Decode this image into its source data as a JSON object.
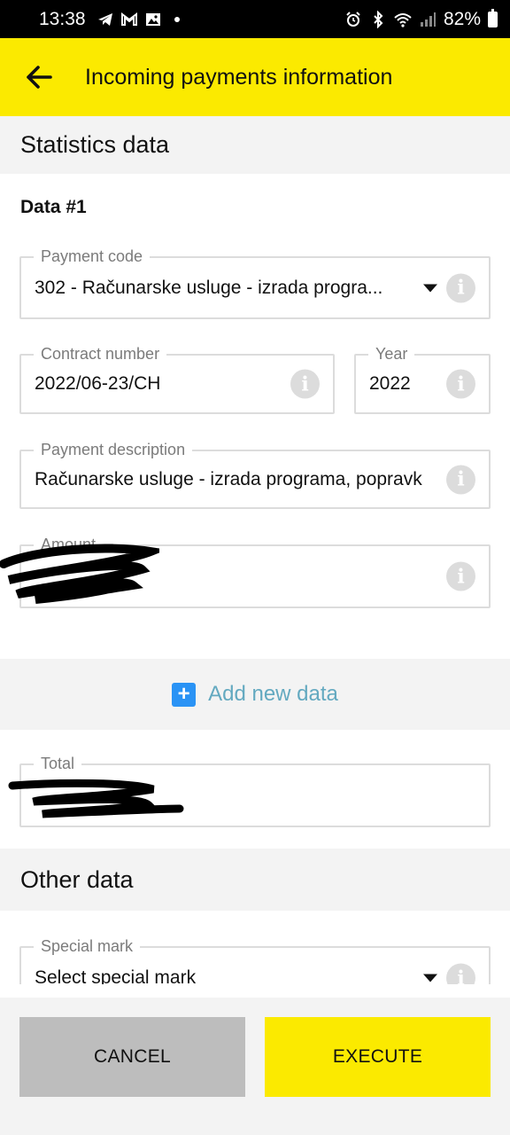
{
  "status_bar": {
    "time": "13:38",
    "battery": "82%",
    "left_icons": [
      "telegram-icon",
      "gmail-icon",
      "gallery-icon",
      "dot-icon"
    ],
    "right_icons": [
      "alarm-icon",
      "bluetooth-icon",
      "wifi-icon",
      "signal-icon"
    ]
  },
  "app_bar": {
    "title": "Incoming payments information",
    "back_icon": "arrow-left-icon",
    "background": "#fbea00"
  },
  "statistics": {
    "heading": "Statistics data",
    "data_heading": "Data #1",
    "payment_code": {
      "label": "Payment code",
      "value": "302 - Računarske usluge - izrada progra..."
    },
    "contract_number": {
      "label": "Contract number",
      "value": "2022/06-23/CH"
    },
    "year": {
      "label": "Year",
      "value": "2022"
    },
    "payment_description": {
      "label": "Payment description",
      "value": "Računarske usluge - izrada programa, popravk"
    },
    "amount": {
      "label": "Amount"
    }
  },
  "add_new": {
    "label": "Add new data",
    "icon": "plus-square-icon"
  },
  "total": {
    "label": "Total"
  },
  "other": {
    "heading": "Other data",
    "special_mark": {
      "label": "Special mark",
      "placeholder": "Select special mark"
    }
  },
  "actions": {
    "cancel": "CANCEL",
    "execute": "EXECUTE"
  },
  "colors": {
    "accent_yellow": "#fbea00",
    "add_icon_blue": "#2a93f5",
    "add_text": "#63a9c0",
    "cancel_gray": "#bdbdbd"
  }
}
